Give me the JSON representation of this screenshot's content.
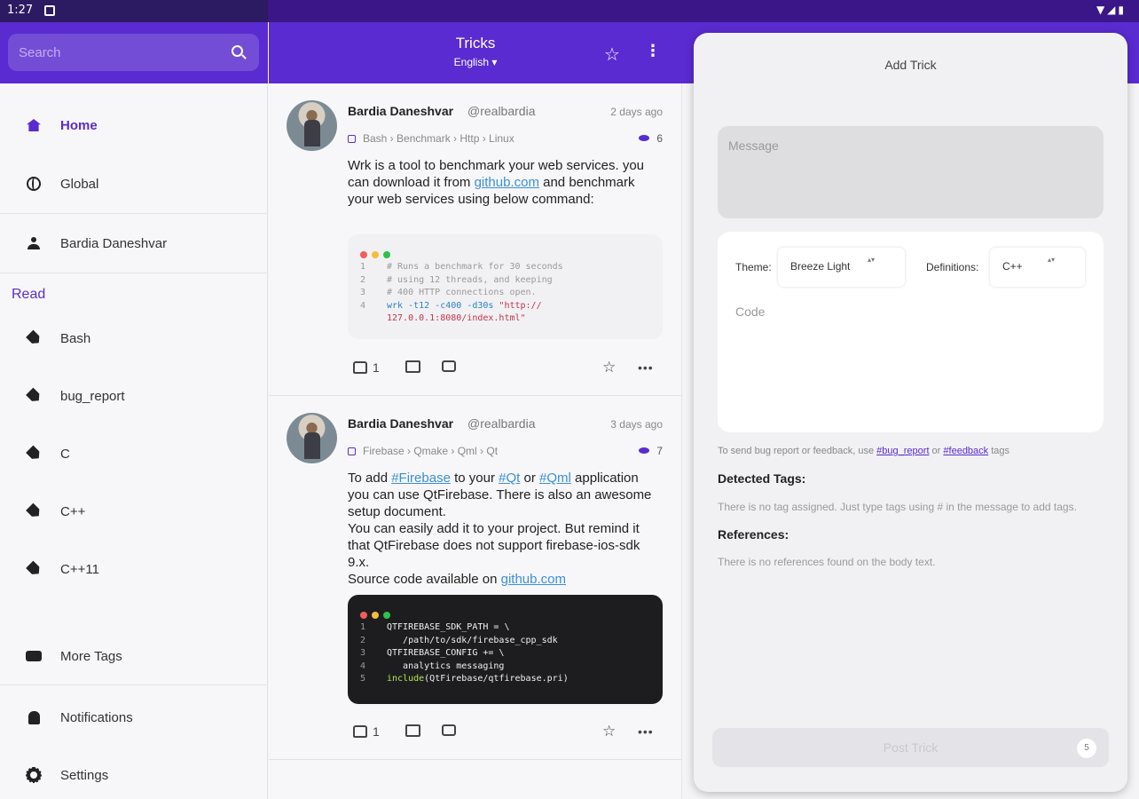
{
  "status_bar": {
    "time": "1:27"
  },
  "search": {
    "placeholder": "Search"
  },
  "sidebar": {
    "items": [
      {
        "label": "Home"
      },
      {
        "label": "Global"
      },
      {
        "label": "Bardia Daneshvar"
      }
    ],
    "read_label": "Read",
    "tags": [
      "Bash",
      "bug_report",
      "C",
      "C++",
      "C++11"
    ],
    "more_tags": "More Tags",
    "notifications": "Notifications",
    "settings": "Settings"
  },
  "header": {
    "title": "Tricks",
    "language": "English"
  },
  "posts": [
    {
      "author": "Bardia Daneshvar",
      "handle": "@realbardia",
      "date": "2 days ago",
      "tags": "Bash › Benchmark › Http › Linux",
      "views": "6",
      "body_1": "Wrk is a tool to benchmark your web services. you can download it from ",
      "link": "github.com",
      "body_2": " and benchmark your web services using below command:",
      "code": {
        "l1": "# Runs a benchmark for 30 seconds",
        "l2": "# using 12 threads, and keeping",
        "l3": "# 400 HTTP connections open.",
        "l4_cmd": "wrk -t12 -c400 -d30s ",
        "l4_str": "\"http://",
        "l5_str": "127.0.0.1:8080/index.html\""
      },
      "likes": "1"
    },
    {
      "author": "Bardia Daneshvar",
      "handle": "@realbardia",
      "date": "3 days ago",
      "tags": "Firebase › Qmake › Qml › Qt",
      "views": "7",
      "t1": "To add ",
      "h1": "#Firebase",
      "t2": " to your ",
      "h2": "#Qt",
      "t3": " or ",
      "h3": "#Qml",
      "t4": " application you can use QtFirebase. There is also an awesome setup document.",
      "t5": "You can easily add it to your project. But remind it that QtFirebase does not support firebase-ios-sdk 9.x.",
      "t6": "Source code available on ",
      "link": "github.com",
      "code": {
        "l1": "QTFIREBASE_SDK_PATH = \\",
        "l2": "   /path/to/sdk/firebase_cpp_sdk",
        "l3": "QTFIREBASE_CONFIG += \\",
        "l4": "   analytics messaging",
        "l5_kw": "include",
        "l5_rest": "(QtFirebase/qtfirebase.pri)"
      },
      "likes": "1"
    }
  ],
  "add_trick": {
    "title": "Add Trick",
    "message_placeholder": "Message",
    "theme_label": "Theme:",
    "theme_value": "Breeze Light",
    "definitions_label": "Definitions:",
    "definitions_value": "C++",
    "code_placeholder": "Code",
    "hint_1": "To send bug report or feedback, use ",
    "hint_tag1": "#bug_report",
    "hint_2": " or ",
    "hint_tag2": "#feedback",
    "hint_3": " tags",
    "detected_tags_title": "Detected Tags:",
    "detected_tags_text": "There is no tag assigned. Just type tags using # in the message to add tags.",
    "references_title": "References:",
    "references_text": "There is no references found on the body text.",
    "post_button": "Post Trick",
    "counter": "5"
  },
  "colors": {
    "primary": "#5a2bd0",
    "link": "#3a8fd8",
    "status_bar": "#3a1688"
  }
}
